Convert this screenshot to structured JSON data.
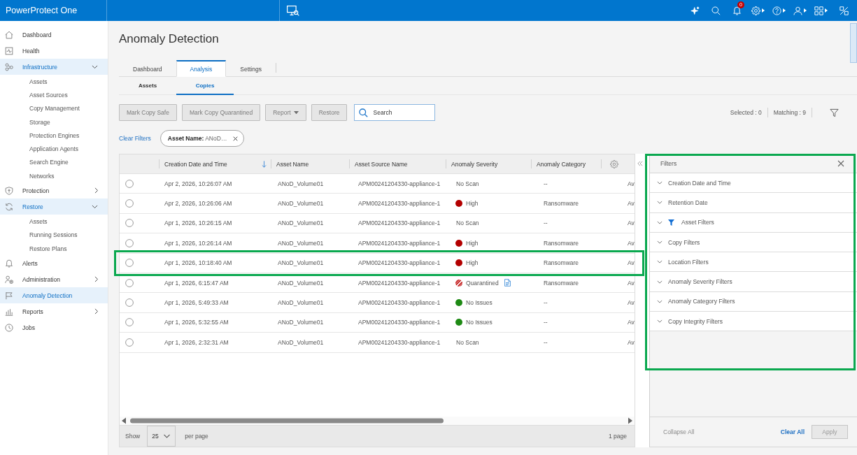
{
  "top_bar": {
    "product": "PowerProtect One",
    "notification_count": "0"
  },
  "sidebar": {
    "items": [
      {
        "label": "Dashboard",
        "kind": "link",
        "selected": false
      },
      {
        "label": "Health",
        "kind": "link",
        "selected": false
      },
      {
        "label": "Infrastructure",
        "kind": "group",
        "expanded": true,
        "children": [
          {
            "label": "Assets",
            "selected": false
          },
          {
            "label": "Asset Sources",
            "selected": false
          },
          {
            "label": "Copy Management",
            "selected": false
          },
          {
            "label": "Storage",
            "selected": false
          },
          {
            "label": "Protection Engines",
            "selected": false
          },
          {
            "label": "Application Agents",
            "selected": false
          },
          {
            "label": "Search Engine",
            "selected": false
          },
          {
            "label": "Networks",
            "selected": false
          }
        ]
      },
      {
        "label": "Protection",
        "kind": "group",
        "expanded": false
      },
      {
        "label": "Restore",
        "kind": "group",
        "expanded": true,
        "children": [
          {
            "label": "Assets",
            "selected": false
          },
          {
            "label": "Running Sessions",
            "selected": false
          },
          {
            "label": "Restore Plans",
            "selected": false
          }
        ]
      },
      {
        "label": "Alerts",
        "kind": "link",
        "selected": false
      },
      {
        "label": "Administration",
        "kind": "group",
        "expanded": false
      },
      {
        "label": "Anomaly Detection",
        "kind": "link",
        "selected": true
      },
      {
        "label": "Reports",
        "kind": "group",
        "expanded": false
      },
      {
        "label": "Jobs",
        "kind": "link",
        "selected": false
      }
    ]
  },
  "page": {
    "title": "Anomaly Detection",
    "tabs": [
      {
        "label": "Dashboard",
        "selected": false
      },
      {
        "label": "Analysis",
        "selected": true
      },
      {
        "label": "Settings",
        "selected": false
      }
    ],
    "subtabs": [
      {
        "label": "Assets",
        "selected": false
      },
      {
        "label": "Copies",
        "selected": true
      }
    ]
  },
  "toolbar": {
    "buttons": [
      {
        "label": "Mark Copy Safe",
        "kind": "plain",
        "disabled": true
      },
      {
        "label": "Mark Copy Quarantined",
        "kind": "plain",
        "disabled": true
      },
      {
        "label": "Report",
        "kind": "dropdown",
        "disabled": true
      },
      {
        "label": "Restore",
        "kind": "plain",
        "disabled": true
      }
    ],
    "search": {
      "placeholder": "Search"
    },
    "selected_count": "Selected : 0",
    "matching_count": "Matching : 9"
  },
  "active_filters": {
    "clear_label": "Clear Filters",
    "chips": [
      {
        "text": "**Asset Name:** ANoD…"
      }
    ]
  },
  "table": {
    "columns": [
      {
        "label": "Creation Date and Time",
        "sorted": true
      },
      {
        "label": "Asset Name",
        "sorted": false
      },
      {
        "label": "Asset Source Name",
        "sorted": false
      },
      {
        "label": "Anomaly Severity",
        "sorted": false
      },
      {
        "label": "Anomaly Category",
        "sorted": false
      }
    ],
    "rows": [
      {
        "selected": false,
        "highlighted": false,
        "created": "Apr 2, 2026, 10:26:07 AM",
        "asset_name": "ANoD_Volume01",
        "asset_source": "APM00241204330-appliance-1",
        "severity": {
          "kind": "text",
          "label": "No Scan"
        },
        "category": "--",
        "column_7": "Av"
      },
      {
        "selected": false,
        "highlighted": false,
        "created": "Apr 2, 2026, 10:26:06 AM",
        "asset_name": "ANoD_Volume01",
        "asset_source": "APM00241204330-appliance-1",
        "severity": {
          "kind": "dot",
          "label": "High",
          "color": "#b30000"
        },
        "category": "Ransomware",
        "column_7": "Av"
      },
      {
        "selected": false,
        "highlighted": false,
        "created": "Apr 1, 2026, 10:26:15 AM",
        "asset_name": "ANoD_Volume01",
        "asset_source": "APM00241204330-appliance-1",
        "severity": {
          "kind": "text",
          "label": "No Scan"
        },
        "category": "--",
        "column_7": "Av"
      },
      {
        "selected": false,
        "highlighted": false,
        "created": "Apr 1, 2026, 10:26:14 AM",
        "asset_name": "ANoD_Volume01",
        "asset_source": "APM00241204330-appliance-1",
        "severity": {
          "kind": "dot",
          "label": "High",
          "color": "#b30000"
        },
        "category": "Ransomware",
        "column_7": "Av"
      },
      {
        "selected": false,
        "highlighted": true,
        "created": "Apr 1, 2026, 10:18:40 AM",
        "asset_name": "ANoD_Volume01",
        "asset_source": "APM00241204330-appliance-1",
        "severity": {
          "kind": "dot",
          "label": "High",
          "color": "#b30000"
        },
        "category": "Ransomware",
        "column_7": "Av"
      },
      {
        "selected": false,
        "highlighted": false,
        "created": "Apr 1, 2026, 6:15:47 AM",
        "asset_name": "ANoD_Volume01",
        "asset_source": "APM00241204330-appliance-1",
        "severity": {
          "kind": "striped",
          "label": "Quarantined",
          "color": "#c41e1e"
        },
        "category": "Ransomware",
        "column_7": "Av"
      },
      {
        "selected": false,
        "highlighted": false,
        "created": "Apr 1, 2026, 5:49:33 AM",
        "asset_name": "ANoD_Volume01",
        "asset_source": "APM00241204330-appliance-1",
        "severity": {
          "kind": "dot",
          "label": "No Issues",
          "color": "#1e8a14"
        },
        "category": "--",
        "column_7": "Av"
      },
      {
        "selected": false,
        "highlighted": false,
        "created": "Apr 1, 2026, 5:32:55 AM",
        "asset_name": "ANoD_Volume01",
        "asset_source": "APM00241204330-appliance-1",
        "severity": {
          "kind": "dot",
          "label": "No Issues",
          "color": "#1e8a14"
        },
        "category": "--",
        "column_7": "Av"
      },
      {
        "selected": false,
        "highlighted": false,
        "created": "Apr 1, 2026, 2:32:31 AM",
        "asset_name": "ANoD_Volume01",
        "asset_source": "APM00241204330-appliance-1",
        "severity": {
          "kind": "text",
          "label": "No Scan"
        },
        "category": "--",
        "column_7": "Av"
      }
    ]
  },
  "pagination": {
    "show_label": "Show",
    "page_size": "25",
    "per_page_label": "per page",
    "page_count": "1 page"
  },
  "filters_panel": {
    "title": "Filters",
    "highlighted": true,
    "items": [
      {
        "label": "Creation Date and Time",
        "expanded": false,
        "filtered": false
      },
      {
        "label": "Retention Date",
        "expanded": false,
        "filtered": false
      },
      {
        "label": "Asset Filters",
        "expanded": false,
        "filtered": true
      },
      {
        "label": "Copy Filters",
        "expanded": false,
        "filtered": false
      },
      {
        "label": "Location Filters",
        "expanded": false,
        "filtered": false
      },
      {
        "label": "Anomaly Severity Filters",
        "expanded": false,
        "filtered": false
      },
      {
        "label": "Anomaly Category Filters",
        "expanded": false,
        "filtered": false
      },
      {
        "label": "Copy Integrity Filters",
        "expanded": false,
        "filtered": false
      }
    ],
    "collapse_all": "Collapse All",
    "clear_all": "Clear All",
    "apply": {
      "label": "Apply",
      "disabled": true
    }
  }
}
